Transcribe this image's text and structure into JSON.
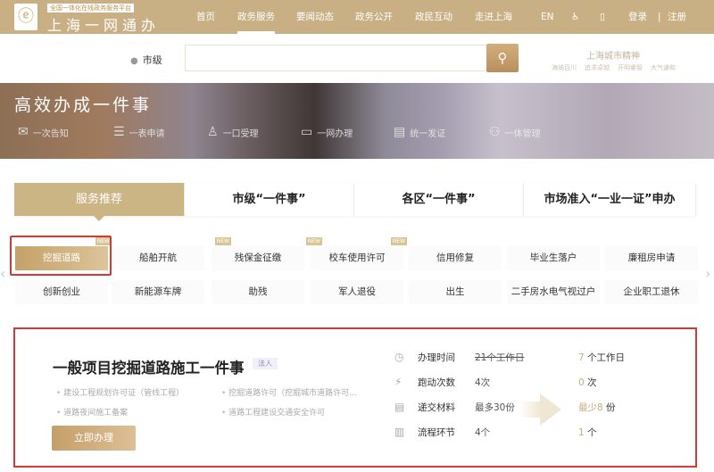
{
  "header": {
    "logo_sub": "全国一体化在线政务服务平台",
    "logo_main": "上海一网通办",
    "nav": [
      "首页",
      "政务服务",
      "要闻动态",
      "政务公开",
      "政民互动",
      "走进上海"
    ],
    "lang": "EN",
    "login": "登录",
    "separator": "|",
    "register": "注册"
  },
  "search": {
    "location": "市级",
    "placeholder": "",
    "spirit_title": "上海城市精神",
    "spirit_links": [
      "海纳百川",
      "追求卓越",
      "开明睿智",
      "大气谦和"
    ]
  },
  "banner": {
    "title": "高效办成一件事",
    "features": [
      "一次告知",
      "一表申请",
      "一口受理",
      "一网办理",
      "统一发证",
      "一体管理"
    ]
  },
  "tabs": [
    "服务推荐",
    "市级“一件事”",
    "各区“一件事”",
    "市场准入“一业一证”申办"
  ],
  "services": {
    "row1": [
      "挖掘道路",
      "船舶开航",
      "残保金征缴",
      "校车使用许可",
      "信用修复",
      "毕业生落户",
      "廉租房申请"
    ],
    "row2": [
      "创新创业",
      "新能源车牌",
      "助残",
      "军人退役",
      "出生",
      "二手房水电气视过户",
      "企业职工退休"
    ],
    "new_badge": "NEW"
  },
  "detail": {
    "title": "一般项目挖掘道路施工一件事",
    "tag": "法人",
    "items": [
      "建设工程规划许可证（管线工程）",
      "挖掘道路许可（挖掘城市道路许可...",
      "道路夜间施工备案",
      "道路工程建设交通安全许可"
    ],
    "button": "立即办理",
    "stats": [
      {
        "label": "办理时间",
        "before": "21个工作日",
        "after_num": "7",
        "after_unit": " 个工作日"
      },
      {
        "label": "跑动次数",
        "before": "4次",
        "after_num": "0",
        "after_unit": " 次"
      },
      {
        "label": "递交材料",
        "before": "最多30份",
        "after_num": "最少8",
        "after_unit": " 份"
      },
      {
        "label": "流程环节",
        "before": "4个",
        "after_num": "1",
        "after_unit": " 个"
      }
    ]
  }
}
